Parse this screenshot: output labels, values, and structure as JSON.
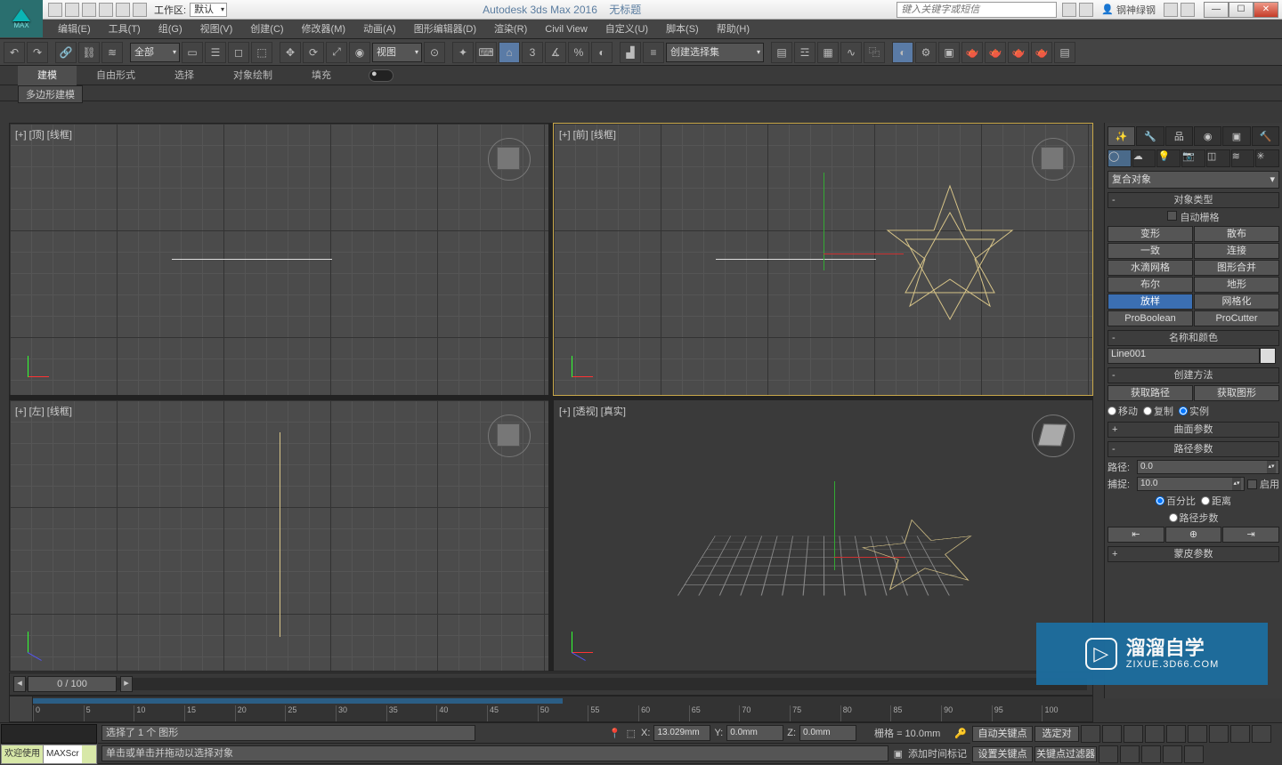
{
  "titlebar": {
    "workspace_label": "工作区:",
    "workspace_value": "默认",
    "app_title": "Autodesk 3ds Max 2016",
    "doc_title": "无标题",
    "search_placeholder": "键入关键字或短信",
    "user": "钢神绿钢"
  },
  "menu": [
    "编辑(E)",
    "工具(T)",
    "组(G)",
    "视图(V)",
    "创建(C)",
    "修改器(M)",
    "动画(A)",
    "图形编辑器(D)",
    "渲染(R)",
    "Civil View",
    "自定义(U)",
    "脚本(S)",
    "帮助(H)"
  ],
  "toolbar": {
    "filter": "全部",
    "refcoord": "视图",
    "selset": "创建选择集",
    "snap_num": "3"
  },
  "ribbon": {
    "tabs": [
      "建模",
      "自由形式",
      "选择",
      "对象绘制",
      "填充"
    ],
    "active": 0,
    "sub": "多边形建模"
  },
  "viewports": {
    "top": "[+] [顶] [线框]",
    "front": "[+] [前] [线框]",
    "left": "[+] [左] [线框]",
    "persp": "[+] [透视] [真实]"
  },
  "cmdpanel": {
    "category": "复合对象",
    "roll_objtype": "对象类型",
    "autogrid": "自动栅格",
    "buttons": [
      "变形",
      "散布",
      "一致",
      "连接",
      "水滴网格",
      "图形合并",
      "布尔",
      "地形",
      "放样",
      "网格化",
      "ProBoolean",
      "ProCutter"
    ],
    "selected_button": "放样",
    "roll_namecolor": "名称和颜色",
    "name_value": "Line001",
    "roll_create": "创建方法",
    "get_path": "获取路径",
    "get_shape": "获取图形",
    "opt_move": "移动",
    "opt_copy": "复制",
    "opt_inst": "实例",
    "roll_surface": "曲面参数",
    "roll_path": "路径参数",
    "path_label": "路径:",
    "path_val": "0.0",
    "snap_label": "捕捉:",
    "snap_val": "10.0",
    "enable": "启用",
    "percent": "百分比",
    "distance": "距离",
    "path_steps": "路径步数",
    "roll_skin": "蒙皮参数"
  },
  "timeline": {
    "pos": "0 / 100",
    "ticks": [
      "0",
      "5",
      "10",
      "15",
      "20",
      "25",
      "30",
      "35",
      "40",
      "45",
      "50",
      "55",
      "60",
      "65",
      "70",
      "75",
      "80",
      "85",
      "90",
      "95",
      "100"
    ]
  },
  "status": {
    "welcome": "欢迎使用",
    "maxscr": "MAXScr",
    "sel_info": "选择了 1 个 图形",
    "prompt": "单击或单击并拖动以选择对象",
    "x": "13.029mm",
    "y": "0.0mm",
    "z": "0.0mm",
    "grid": "栅格 = 10.0mm",
    "autokey": "自动关键点",
    "selset": "选定对",
    "setkey": "设置关键点",
    "keyfilter": "关键点过滤器",
    "addtime": "添加时间标记"
  },
  "watermark": {
    "title": "溜溜自学",
    "site": "ZIXUE.3D66.COM"
  }
}
